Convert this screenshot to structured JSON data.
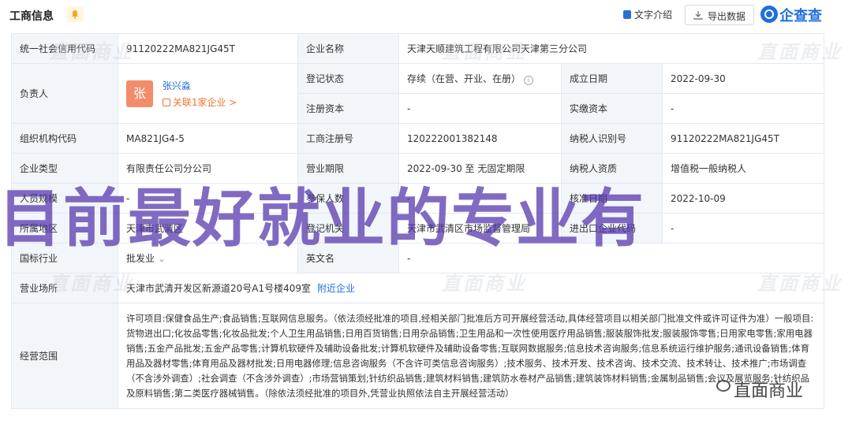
{
  "header": {
    "title": "工商信息",
    "intro_label": "文字介绍",
    "export_label": "导出数据",
    "logo_text": "企查查"
  },
  "labels": {
    "credit_code": "统一社会信用代码",
    "company_name": "企业名称",
    "legal_rep": "负责人",
    "reg_status": "登记状态",
    "established": "成立日期",
    "reg_capital": "注册资本",
    "paid_capital": "实缴资本",
    "org_code": "组织机构代码",
    "reg_number": "工商注册号",
    "taxpayer_id": "纳税人识别号",
    "company_type": "企业类型",
    "term": "营业期限",
    "taxpayer_qual": "纳税人资质",
    "staff_size": "人员规模",
    "insured": "参保人数",
    "approval_date": "核准日期",
    "region": "所属地区",
    "authority": "登记机关",
    "import_export": "进出口企业代码",
    "industry": "国标行业",
    "english_name": "英文名",
    "address": "营业场所",
    "scope": "经营范围"
  },
  "values": {
    "credit_code": "91120222MA821JG45T",
    "company_name": "天津天顺建筑工程有限公司天津第三分公司",
    "person_avatar": "张",
    "person_name": "张兴淼",
    "person_related": "关联1家企业 >",
    "reg_status": "存续（在营、开业、在册）",
    "established": "2022-09-30",
    "reg_capital": "-",
    "paid_capital": "-",
    "org_code": "MA821JG4-5",
    "reg_number": "120222001382148",
    "taxpayer_id": "91120222MA821JG45T",
    "company_type": "有限责任公司分公司",
    "term": "2022-09-30 至 无固定期限",
    "taxpayer_qual": "增值税一般纳税人",
    "staff_size": "-",
    "insured": "-",
    "approval_date": "2022-10-09",
    "region": "天津市武清区",
    "authority": "天津市武清区市场监督管理局",
    "import_export": "-",
    "industry": "批发业",
    "english_name": "-",
    "address": "天津市武清开发区新源道20号A1号楼409室",
    "address_link": "附近企业",
    "scope": "许可项目:保健食品生产;食品销售;互联网信息服务。（依法须经批准的项目,经相关部门批准后方可开展经营活动,具体经营项目以相关部门批准文件或许可证件为准）一般项目:货物进出口;化妆品零售;化妆品批发;个人卫生用品销售;日用百货销售;日用杂品销售;卫生用品和一次性使用医疗用品销售;服装服饰批发;服装服饰零售;日用家电零售;家用电器销售;五金产品批发;五金产品零售;计算机软硬件及辅助设备批发;计算机软硬件及辅助设备零售;互联网数据服务;信息技术咨询服务;信息系统运行维护服务;通讯设备销售;体育用品及器材零售;体育用品及器材批发;日用电器修理;信息咨询服务（不含许可类信息咨询服务）;技术服务、技术开发、技术咨询、技术交流、技术转让、技术推广;市场调查（不含涉外调查）;社会调查（不含涉外调查）;市场营销策划;针纺织品销售;建筑材料销售;建筑防水卷材产品销售;建筑装饰材料销售;金属制品销售;会议及展览服务;针纺织品及原料销售;第二类医疗器械销售。（除依法须经批准的项目外,凭营业执照依法自主开展经营活动）"
  },
  "watermark": "直面商业",
  "overlay_text": "目前最好就业的专业有",
  "wechat_tag": "直面商业"
}
